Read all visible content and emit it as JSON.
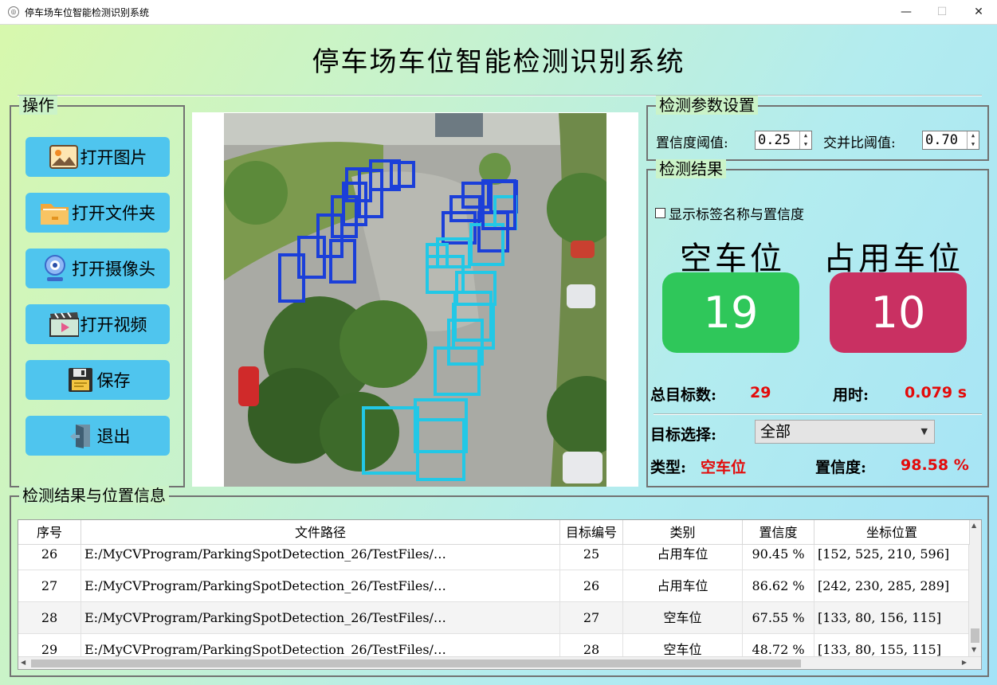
{
  "window": {
    "title": "停车场车位智能检测识别系统",
    "min": "—",
    "max": "☐",
    "close": "✕"
  },
  "app_title": "停车场车位智能检测识别系统",
  "ops": {
    "legend": "操作",
    "buttons": [
      {
        "label": "打开图片",
        "icon": "image-icon"
      },
      {
        "label": "打开文件夹",
        "icon": "folder-icon"
      },
      {
        "label": "打开摄像头",
        "icon": "webcam-icon"
      },
      {
        "label": "打开视频",
        "icon": "video-icon"
      },
      {
        "label": "保存",
        "icon": "floppy-icon"
      },
      {
        "label": "退出",
        "icon": "exit-icon"
      }
    ]
  },
  "params": {
    "legend": "检测参数设置",
    "conf_label": "置信度阈值:",
    "conf_value": "0.25",
    "iou_label": "交并比阈值:",
    "iou_value": "0.70"
  },
  "results": {
    "legend": "检测结果",
    "show_labels": "显示标签名称与置信度",
    "empty_label": "空车位",
    "occupied_label": "占用车位",
    "empty_count": "19",
    "occupied_count": "10",
    "total_label": "总目标数:",
    "total_value": "29",
    "time_label": "用时:",
    "time_value": "0.079 s",
    "target_label": "目标选择:",
    "target_value": "全部",
    "type_label": "类型:",
    "type_value": "空车位",
    "conf_label": "置信度:",
    "conf_value": "98.58 %"
  },
  "colors": {
    "empty": "#2fc75a",
    "occupied": "#c93062",
    "button": "#4fc5ee",
    "value_red": "#e30b0b"
  },
  "table": {
    "legend": "检测结果与位置信息",
    "columns": [
      "序号",
      "文件路径",
      "目标编号",
      "类别",
      "置信度",
      "坐标位置"
    ],
    "rows": [
      [
        "26",
        "E:/MyCVProgram/ParkingSpotDetection_26/TestFiles/…",
        "25",
        "占用车位",
        "90.45 %",
        "[152, 525, 210, 596]"
      ],
      [
        "27",
        "E:/MyCVProgram/ParkingSpotDetection_26/TestFiles/…",
        "26",
        "占用车位",
        "86.62 %",
        "[242, 230, 285, 289]"
      ],
      [
        "28",
        "E:/MyCVProgram/ParkingSpotDetection_26/TestFiles/…",
        "27",
        "空车位",
        "67.55 %",
        "[133, 80, 156, 115]"
      ],
      [
        "29",
        "E:/MyCVProgram/ParkingSpotDetection_26/TestFiles/…",
        "28",
        "空车位",
        "48.72 %",
        "[133, 80, 155, 115]"
      ]
    ]
  }
}
